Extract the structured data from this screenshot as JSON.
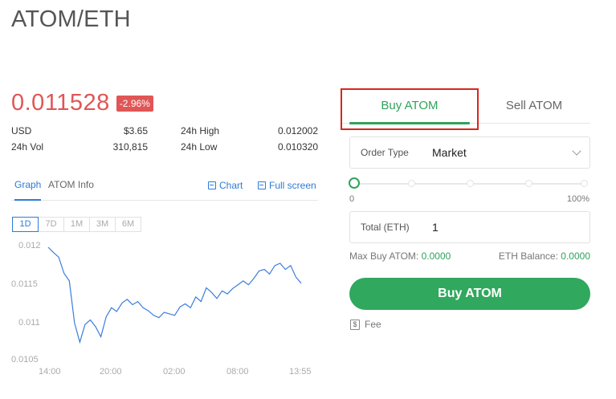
{
  "pair": "ATOM/ETH",
  "price": "0.011528",
  "change": "-2.96%",
  "stats": {
    "usd_label": "USD",
    "usd_value": "$3.65",
    "high_label": "24h High",
    "high_value": "0.012002",
    "vol_label": "24h Vol",
    "vol_value": "310,815",
    "low_label": "24h Low",
    "low_value": "0.010320"
  },
  "graph_tabs": {
    "graph": "Graph",
    "info": "ATOM Info",
    "chart": "Chart",
    "fullscreen": "Full screen"
  },
  "ranges": [
    "1D",
    "7D",
    "1M",
    "3M",
    "6M"
  ],
  "active_range": "1D",
  "trade": {
    "buy_tab": "Buy ATOM",
    "sell_tab": "Sell ATOM",
    "order_type_label": "Order Type",
    "order_type_value": "Market",
    "slider_min": "0",
    "slider_max": "100%",
    "slider_value": 0,
    "total_label": "Total (ETH)",
    "total_value": "1",
    "max_buy_label": "Max Buy ATOM:",
    "max_buy_value": "0.0000",
    "balance_label": "ETH Balance:",
    "balance_value": "0.0000",
    "buy_button": "Buy ATOM",
    "fee_label": "Fee"
  },
  "colors": {
    "accent_green": "#30a85d",
    "price_red": "#e05656",
    "link_blue": "#2d7bd6",
    "highlight_red": "#d9261c"
  },
  "chart_data": {
    "type": "line",
    "x_ticks": [
      "14:00",
      "20:00",
      "02:00",
      "08:00",
      "13:55"
    ],
    "y_ticks": [
      "0.012",
      "0.0115",
      "0.011",
      "0.0105"
    ],
    "ylim": [
      0.0105,
      0.012
    ],
    "x": [
      "14:00",
      "14:30",
      "15:00",
      "15:30",
      "16:00",
      "16:30",
      "17:00",
      "17:30",
      "18:00",
      "18:30",
      "19:00",
      "19:30",
      "20:00",
      "20:30",
      "21:00",
      "21:30",
      "22:00",
      "22:30",
      "23:00",
      "23:30",
      "00:00",
      "00:30",
      "01:00",
      "01:30",
      "02:00",
      "02:30",
      "03:00",
      "03:30",
      "04:00",
      "04:30",
      "05:00",
      "05:30",
      "06:00",
      "06:30",
      "07:00",
      "07:30",
      "08:00",
      "08:30",
      "09:00",
      "09:30",
      "10:00",
      "10:30",
      "11:00",
      "11:30",
      "12:00",
      "12:30",
      "13:00",
      "13:30",
      "13:55"
    ],
    "values": [
      0.01199,
      0.01192,
      0.01186,
      0.01165,
      0.01155,
      0.011,
      0.01075,
      0.01098,
      0.01104,
      0.01095,
      0.01082,
      0.01108,
      0.0112,
      0.01115,
      0.01126,
      0.01131,
      0.01124,
      0.01128,
      0.0112,
      0.01116,
      0.0111,
      0.01107,
      0.01114,
      0.01112,
      0.0111,
      0.01121,
      0.01125,
      0.0112,
      0.01134,
      0.01128,
      0.01146,
      0.0114,
      0.01132,
      0.01142,
      0.01138,
      0.01145,
      0.0115,
      0.01155,
      0.0115,
      0.01158,
      0.01168,
      0.0117,
      0.01164,
      0.01175,
      0.01178,
      0.0117,
      0.01175,
      0.0116,
      0.01152
    ]
  }
}
